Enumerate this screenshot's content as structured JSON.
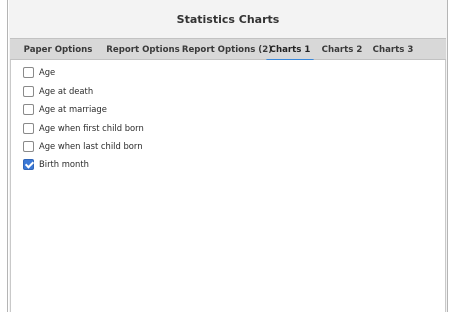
{
  "dialog": {
    "title": "Statistics Charts"
  },
  "tabs": [
    {
      "label": "Paper Options",
      "active": false
    },
    {
      "label": "Report Options",
      "active": false
    },
    {
      "label": "Report Options (2)",
      "active": false
    },
    {
      "label": "Charts 1",
      "active": true
    },
    {
      "label": "Charts 2",
      "active": false
    },
    {
      "label": "Charts 3",
      "active": false
    }
  ],
  "options": [
    {
      "label": "Age",
      "checked": false
    },
    {
      "label": "Age at death",
      "checked": false
    },
    {
      "label": "Age at marriage",
      "checked": false
    },
    {
      "label": "Age when first child born",
      "checked": false
    },
    {
      "label": "Age when last child born",
      "checked": false
    },
    {
      "label": "Birth month",
      "checked": true
    }
  ],
  "colors": {
    "accent": "#3a78d6",
    "tab_underline": "#3a87d8"
  }
}
